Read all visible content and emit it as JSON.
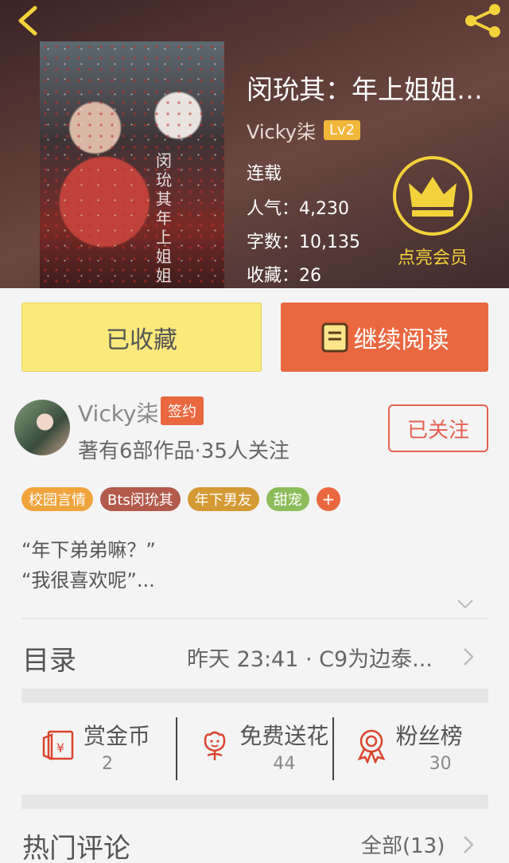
{
  "book": {
    "title": "闵玧其：年上姐姐…",
    "author": "Vicky柒",
    "level": "Lv2",
    "status": "连载",
    "popularity": "人气：4,230",
    "word_count": "字数：10,135",
    "favorites": "收藏：26",
    "cover_text": "闵玧其 年上姐姐"
  },
  "vip": {
    "label": "点亮会员"
  },
  "actions": {
    "favorited_label": "已收藏",
    "read_label": "继续阅读"
  },
  "author": {
    "name": "Vicky柒",
    "badge": "签约",
    "meta": "著有6部作品·35人关注",
    "follow_label": "已关注"
  },
  "tags": [
    {
      "label": "校园言情",
      "color": "#f0a43c"
    },
    {
      "label": "Bts闵玧其",
      "color": "#b25a4c"
    },
    {
      "label": "年下男友",
      "color": "#d59a33"
    },
    {
      "label": "甜宠",
      "color": "#8dbd5a"
    },
    {
      "label": "+",
      "color": "#ea6840"
    }
  ],
  "intro": {
    "line1": "“年下弟弟嘛？”",
    "line2": "“我很喜欢呢”..."
  },
  "catalog": {
    "label": "目录",
    "latest": "昨天 23:41 · C9为边泰..."
  },
  "support": {
    "coins": {
      "label": "赏金币",
      "count": "2"
    },
    "flowers": {
      "label": "免费送花",
      "count": "44"
    },
    "fans": {
      "label": "粉丝榜",
      "count": "30"
    }
  },
  "comments": {
    "label": "热门评论",
    "all": "全部(13)"
  },
  "colors": {
    "accent": "#ea6840",
    "fav_button": "#fbe97c",
    "vip_gold": "#f3d23b"
  }
}
